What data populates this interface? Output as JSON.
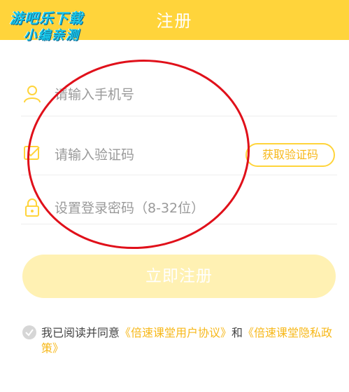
{
  "header": {
    "title": "注册",
    "watermark_line1": "游吧乐下载",
    "watermark_line2": "小编亲测"
  },
  "form": {
    "phone_placeholder": "请输入手机号",
    "code_placeholder": "请输入验证码",
    "get_code_label": "获取验证码",
    "password_placeholder": "设置登录密码（8-32位）"
  },
  "register_label": "立即注册",
  "agreement": {
    "prefix": "我已阅读并同意",
    "user_agreement": "《倍速课堂用户协议》",
    "and": "和",
    "privacy_policy": "《倍速课堂隐私政策》"
  },
  "colors": {
    "accent": "#ffd43b",
    "link": "#f7b81a",
    "annotation": "#e0101a"
  }
}
